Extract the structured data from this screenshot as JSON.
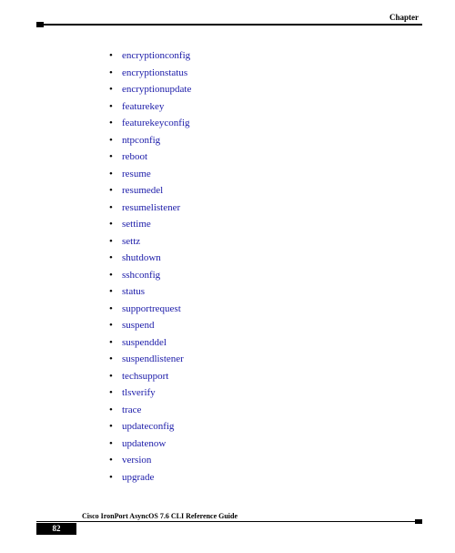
{
  "header": {
    "chapter_label": "Chapter"
  },
  "commands": [
    "encryptionconfig",
    "encryptionstatus",
    "encryptionupdate",
    "featurekey",
    "featurekeyconfig",
    "ntpconfig",
    "reboot",
    "resume",
    "resumedel",
    "resumelistener",
    "settime",
    "settz",
    "shutdown",
    "sshconfig",
    "status",
    "supportrequest",
    "suspend",
    "suspenddel",
    "suspendlistener",
    "techsupport",
    "tlsverify",
    "trace",
    "updateconfig",
    "updatenow",
    "version",
    "upgrade"
  ],
  "footer": {
    "doc_title": "Cisco IronPort AsyncOS 7.6 CLI Reference Guide",
    "page_number": "82"
  }
}
